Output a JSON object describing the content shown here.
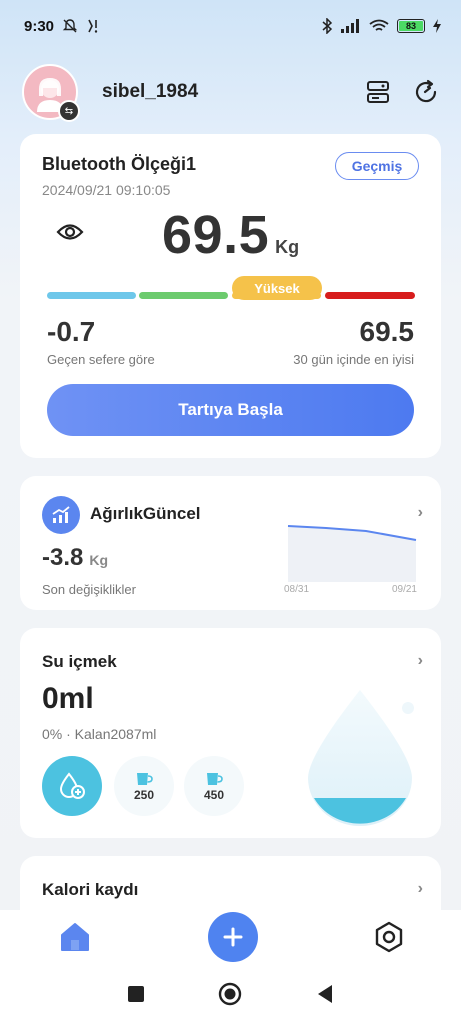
{
  "status_bar": {
    "time": "9:30",
    "battery": "83"
  },
  "header": {
    "username": "sibel_1984"
  },
  "scale_card": {
    "device_name": "Bluetooth Ölçeği1",
    "timestamp": "2024/09/21 09:10:05",
    "history_label": "Geçmiş",
    "weight": "69.5",
    "unit": "Kg",
    "status": "Yüksek",
    "diff_value": "-0.7",
    "diff_label": "Geçen sefere göre",
    "best_value": "69.5",
    "best_label": "30 gün içinde en iyisi",
    "start_label": "Tartıya Başla",
    "bar_colors": [
      "#6ec7ea",
      "#6ccb6e",
      "#f5c24a",
      "#d71d1d"
    ]
  },
  "weight_card": {
    "title": "AğırlıkGüncel",
    "change_value": "-3.8",
    "change_unit": "Kg",
    "change_label": "Son değişiklikler",
    "axis_start": "08/31",
    "axis_end": "09/21"
  },
  "water_card": {
    "title": "Su içmek",
    "amount": "0ml",
    "subtitle": "0% · Kalan2087ml",
    "cup_small": "250",
    "cup_large": "450"
  },
  "calorie_card": {
    "title": "Kalori kaydı"
  },
  "colors": {
    "accent": "#4f83f0",
    "water": "#4cc2e0",
    "status_high": "#f5c24a"
  },
  "icons": {
    "nav_home": "home-icon",
    "nav_add": "plus-icon",
    "nav_settings": "hexagon-settings-icon"
  }
}
